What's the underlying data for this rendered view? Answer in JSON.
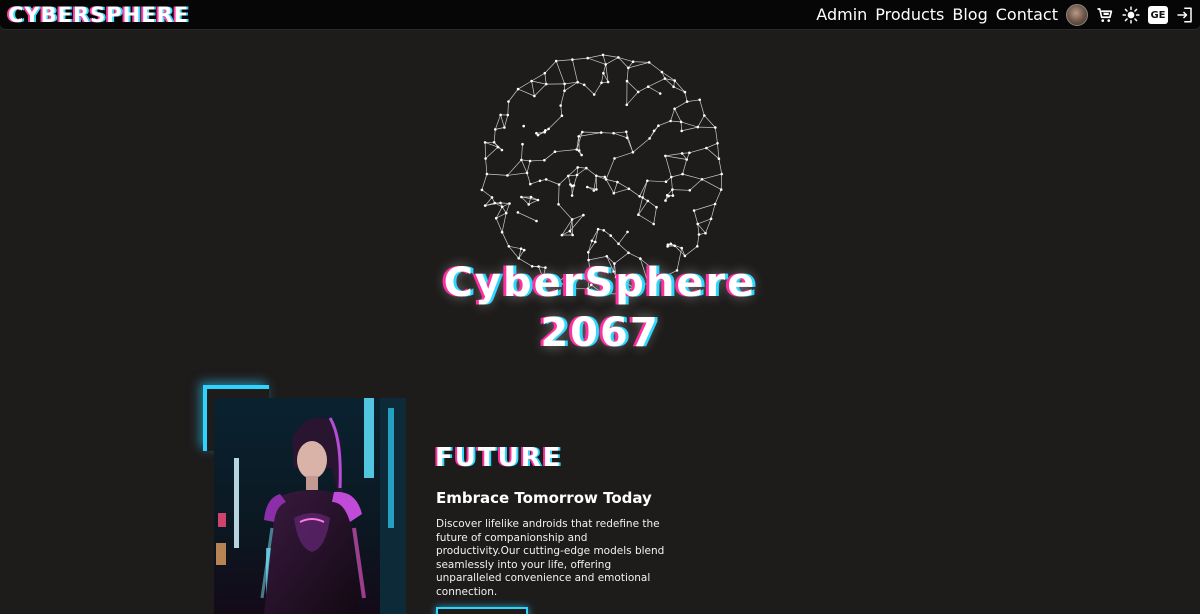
{
  "nav": {
    "logo": "CYBERSPHERE",
    "links": [
      "Admin",
      "Products",
      "Blog",
      "Contact"
    ],
    "language": "GE",
    "icons": [
      "avatar",
      "cart-icon",
      "sun-icon",
      "language-badge",
      "logout-icon"
    ]
  },
  "hero": {
    "title_line1": "CyberSphere",
    "title_line2": "2067",
    "graphic": "wireframe-globe"
  },
  "feature": {
    "heading": "FUTURE",
    "subtitle": "Embrace Tomorrow Today",
    "body": "Discover lifelike androids that redefine the future of companionship and productivity.Our cutting-edge models blend seamlessly into your life, offering unparalleled convenience and emotional connection.",
    "image": "android-woman-neon-street"
  },
  "colors": {
    "background": "#1e1b1b",
    "navbar": "#060606",
    "neon_cyan": "#2fd3ff",
    "neon_pink": "#ff2fa0"
  }
}
